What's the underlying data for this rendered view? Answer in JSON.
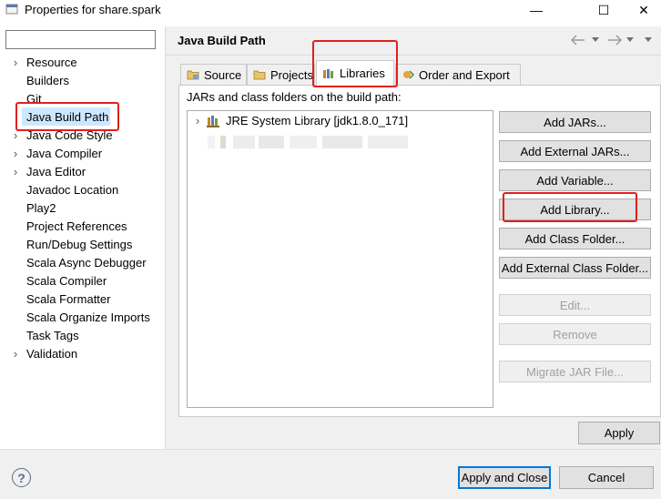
{
  "window": {
    "title": "Properties for share.spark",
    "minimize_glyph": "—",
    "maximize_glyph": "☐",
    "close_glyph": "✕"
  },
  "sidebar": {
    "filter_value": "",
    "items": [
      {
        "label": "Resource",
        "expandable": true
      },
      {
        "label": "Builders",
        "expandable": false
      },
      {
        "label": "Git",
        "expandable": false
      },
      {
        "label": "Java Build Path",
        "expandable": false,
        "selected": true
      },
      {
        "label": "Java Code Style",
        "expandable": true
      },
      {
        "label": "Java Compiler",
        "expandable": true
      },
      {
        "label": "Java Editor",
        "expandable": true
      },
      {
        "label": "Javadoc Location",
        "expandable": false
      },
      {
        "label": "Play2",
        "expandable": false
      },
      {
        "label": "Project References",
        "expandable": false
      },
      {
        "label": "Run/Debug Settings",
        "expandable": false
      },
      {
        "label": "Scala Async Debugger",
        "expandable": false
      },
      {
        "label": "Scala Compiler",
        "expandable": false
      },
      {
        "label": "Scala Formatter",
        "expandable": false
      },
      {
        "label": "Scala Organize Imports",
        "expandable": false
      },
      {
        "label": "Task Tags",
        "expandable": false
      },
      {
        "label": "Validation",
        "expandable": true
      }
    ]
  },
  "header": {
    "title": "Java Build Path",
    "back_icon": "arrow-left-icon",
    "forward_icon": "arrow-right-icon",
    "menu_icon": "chevron-down-icon"
  },
  "tabs": [
    {
      "label": "Source",
      "icon": "source-folder-icon"
    },
    {
      "label": "Projects",
      "icon": "projects-folder-icon"
    },
    {
      "label": "Libraries",
      "icon": "libraries-icon",
      "active": true
    },
    {
      "label": "Order and Export",
      "icon": "order-export-icon"
    }
  ],
  "libraries": {
    "caption": "JARs and class folders on the build path:",
    "entries": [
      {
        "label": "JRE System Library [jdk1.8.0_171]"
      }
    ]
  },
  "buttons": {
    "add_jars": "Add JARs...",
    "add_external_jars": "Add External JARs...",
    "add_variable": "Add Variable...",
    "add_library": "Add Library...",
    "add_class_folder": "Add Class Folder...",
    "add_external_class_folder": "Add External Class Folder...",
    "edit": "Edit...",
    "remove": "Remove",
    "migrate_jar": "Migrate JAR File...",
    "apply": "Apply",
    "apply_and_close": "Apply and Close",
    "cancel": "Cancel"
  },
  "help_glyph": "?",
  "colors": {
    "selection": "#cce8ff",
    "annotation_red": "#e0201c",
    "default_button_border": "#0078d7"
  }
}
